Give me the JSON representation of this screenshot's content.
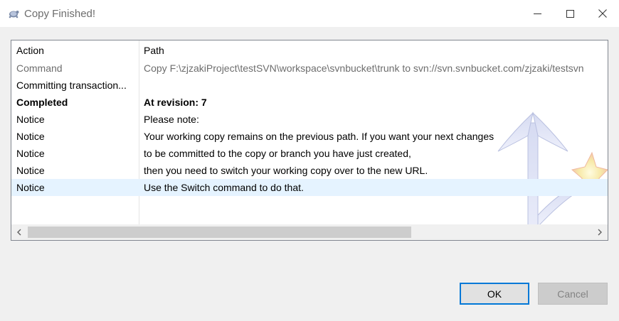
{
  "window": {
    "title": "Copy Finished!",
    "controls": [
      "minimize-icon",
      "maximize-icon",
      "close-icon"
    ]
  },
  "list": {
    "columns": [
      "Action",
      "Path"
    ],
    "rows": [
      {
        "action": "Command",
        "path": "Copy F:\\zjzakiProject\\testSVN\\workspace\\svnbucket\\trunk to svn://svn.svnbucket.com/zjzaki/testsvn"
      },
      {
        "action": "Committing transaction...",
        "path": ""
      },
      {
        "action": "Completed",
        "path": "At revision: 7"
      },
      {
        "action": "Notice",
        "path": "Please note:"
      },
      {
        "action": "Notice",
        "path": "Your working copy remains on the previous path. If you want your next changes"
      },
      {
        "action": "Notice",
        "path": "to be committed to the copy or branch you have just created,"
      },
      {
        "action": "Notice",
        "path": "then you need to switch your working copy over to the new URL."
      },
      {
        "action": "Notice",
        "path": "Use the Switch command to do that."
      }
    ],
    "selected_row": 7,
    "scrollbar_thumb_fraction": 0.68
  },
  "buttons": {
    "ok": "OK",
    "cancel": "Cancel"
  },
  "colors": {
    "accent": "#0078d7",
    "selection": "#e5f3ff",
    "muted_text": "#6d6d6d"
  }
}
